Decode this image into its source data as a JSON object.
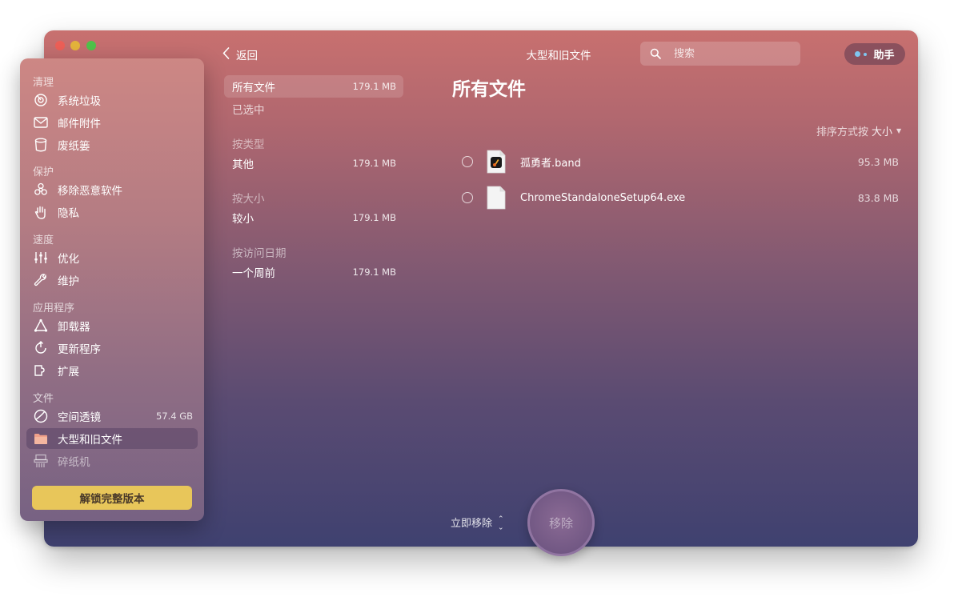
{
  "header": {
    "back_label": "返回",
    "title": "大型和旧文件",
    "search_placeholder": "搜索",
    "assistant_label": "助手"
  },
  "sidebar": {
    "sections": {
      "cleanup": "清理",
      "protection": "保护",
      "speed": "速度",
      "applications": "应用程序",
      "files": "文件"
    },
    "items": {
      "system_junk": "系统垃圾",
      "mail_attachments": "邮件附件",
      "trash_bins": "废纸篓",
      "malware_removal": "移除恶意软件",
      "privacy": "隐私",
      "optimization": "优化",
      "maintenance": "维护",
      "uninstaller": "卸载器",
      "updater": "更新程序",
      "extensions": "扩展",
      "space_lens": "空间透镜",
      "space_lens_size": "57.4 GB",
      "large_old_files": "大型和旧文件",
      "shredder": "碎纸机"
    },
    "unlock_label": "解锁完整版本"
  },
  "filters": {
    "all_files": {
      "label": "所有文件",
      "size": "179.1 MB"
    },
    "selected": {
      "label": "已选中"
    },
    "by_type": "按类型",
    "other": {
      "label": "其他",
      "size": "179.1 MB"
    },
    "by_size": "按大小",
    "small": {
      "label": "较小",
      "size": "179.1 MB"
    },
    "by_access": "按访问日期",
    "one_week": {
      "label": "一个周前",
      "size": "179.1 MB"
    }
  },
  "main": {
    "title": "所有文件",
    "sort_prefix": "排序方式按",
    "sort_value": "大小",
    "files": [
      {
        "name": "孤勇者.band",
        "size": "95.3 MB",
        "icon": "garageband-file-icon"
      },
      {
        "name": "ChromeStandaloneSetup64.exe",
        "size": "83.8 MB",
        "icon": "generic-file-icon"
      }
    ]
  },
  "footer": {
    "remove_mode": "立即移除",
    "remove_button": "移除"
  },
  "colors": {
    "accent_unlock": "#e8c65a",
    "assistant_dot": "#7fc6f0",
    "traffic_red": "#ec5f57",
    "traffic_yellow": "#e3b33b",
    "traffic_green": "#4fc24a"
  }
}
